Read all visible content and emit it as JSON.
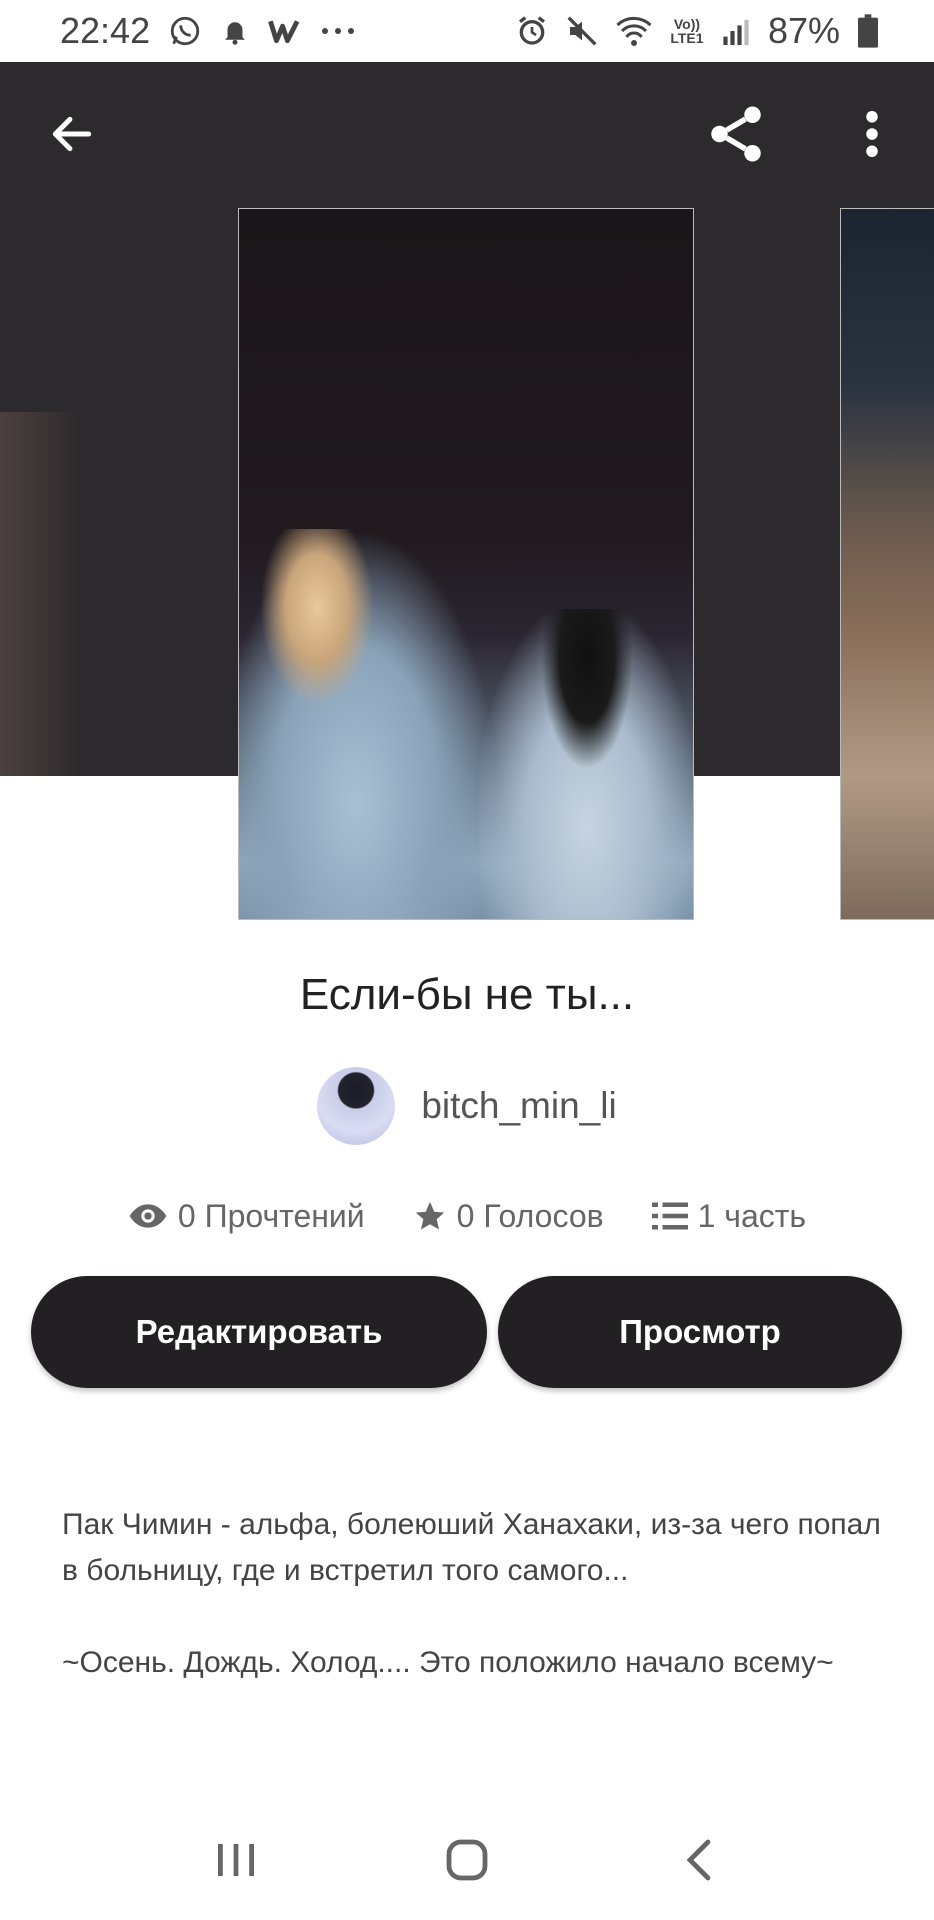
{
  "status_bar": {
    "time": "22:42",
    "left_icons": [
      "whatsapp-icon",
      "notification-bell-icon",
      "wattpad-icon",
      "more-dots-icon"
    ],
    "right_icons": [
      "alarm-icon",
      "mute-icon",
      "wifi-icon",
      "volte-icon",
      "signal-icon",
      "battery-icon"
    ],
    "volte_label": "Vo)) LTE1",
    "battery": "87%"
  },
  "toolbar": {
    "back_icon": "back-arrow-icon",
    "share_icon": "share-icon",
    "more_icon": "more-vertical-icon"
  },
  "story": {
    "title": "Если-бы не ты...",
    "author": "bitch_min_li",
    "stats": {
      "reads": "0 Прочтений",
      "votes": "0 Голосов",
      "parts": "1 часть"
    },
    "buttons": {
      "edit": "Редактировать",
      "view": "Просмотр"
    },
    "description": [
      "Пак Чимин - альфа, болеюший Ханахаки, из-за чего попал в больницу, где и встретил того самого...",
      "~Осень. Дождь. Холод.... Это положило начало всему~"
    ]
  },
  "nav_bar": {
    "icons": [
      "recent-apps-icon",
      "home-icon",
      "back-icon"
    ]
  }
}
